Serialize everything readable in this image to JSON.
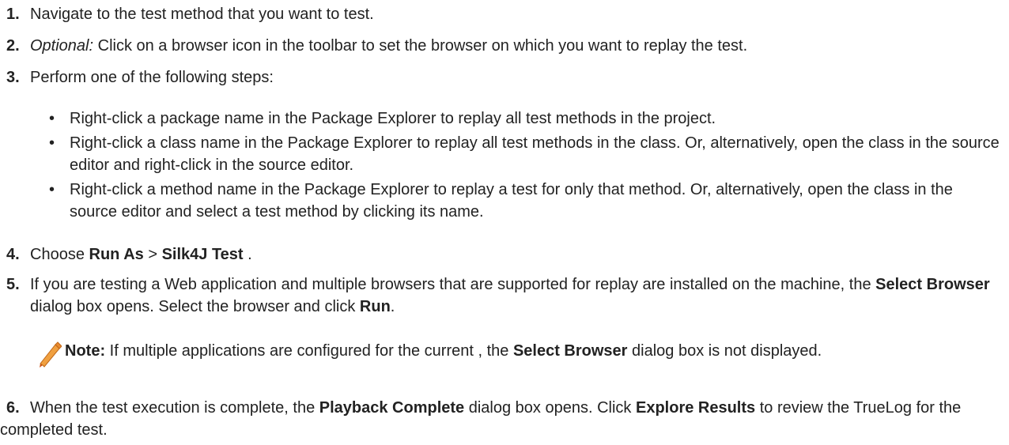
{
  "steps": [
    {
      "number": "1.",
      "text": "Navigate to the test method that you want to test."
    },
    {
      "number": "2.",
      "label": "Optional:",
      "text": " Click on a browser icon in the toolbar to set the browser on which you want to replay the test."
    },
    {
      "number": "3.",
      "text": "Perform one of the following steps:",
      "bullets": [
        "Right-click a package name in the Package Explorer to replay all test methods in the project.",
        "Right-click a class name in the Package Explorer to replay all test methods in the class. Or, alternatively, open the class in the source editor and right-click in the source editor.",
        "Right-click a method name in the Package Explorer to replay a test for only that method. Or, alternatively, open the class in the source editor and select a test method by clicking its name."
      ]
    },
    {
      "number": "4.",
      "pre": "Choose ",
      "b1": "Run As",
      "mid": " > ",
      "b2": "Silk4J Test",
      "post": " ."
    },
    {
      "number": "5.",
      "pre": "If you are testing a Web application and multiple browsers that are supported for replay are installed on the machine, the ",
      "b1": "Select Browser",
      "mid": " dialog box opens. Select the browser and click ",
      "b2": "Run",
      "post": ".",
      "note": {
        "label": "Note:",
        "pre": " If multiple applications are configured for the current , the ",
        "b1": "Select Browser",
        "post": " dialog box is not displayed."
      }
    },
    {
      "number": "6.",
      "pre": "When the test execution is complete, the ",
      "b1": "Playback Complete",
      "mid": " dialog box opens. Click ",
      "b2": "Explore Results",
      "post": " to review the TrueLog for the completed test."
    }
  ],
  "bullet_glyph": "•",
  "colors": {
    "text": "#222222",
    "pencil_body": "#f0a040",
    "pencil_tip": "#d05010"
  }
}
